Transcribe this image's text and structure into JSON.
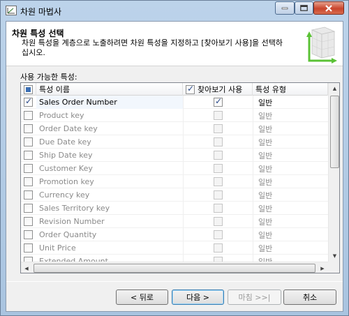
{
  "window": {
    "title": "차원 마법사"
  },
  "header": {
    "title": "차원 특성 선택",
    "description": "차원 특성을 계층으로 노출하려면 차원 특성을 지정하고 [찾아보기 사용]을 선택하십시오."
  },
  "list_label": "사용 가능한 특성:",
  "grid": {
    "columns": {
      "name": "특성 이름",
      "browse": "찾아보기 사용",
      "type": "특성 유형"
    },
    "rows": [
      {
        "name": "Sales Order Number",
        "checked": true,
        "browse": true,
        "type": "일반"
      },
      {
        "name": "Product key",
        "checked": false,
        "browse": false,
        "type": "일반"
      },
      {
        "name": "Order Date key",
        "checked": false,
        "browse": false,
        "type": "일반"
      },
      {
        "name": "Due Date key",
        "checked": false,
        "browse": false,
        "type": "일반"
      },
      {
        "name": "Ship Date key",
        "checked": false,
        "browse": false,
        "type": "일반"
      },
      {
        "name": "Customer Key",
        "checked": false,
        "browse": false,
        "type": "일반"
      },
      {
        "name": "Promotion key",
        "checked": false,
        "browse": false,
        "type": "일반"
      },
      {
        "name": "Currency key",
        "checked": false,
        "browse": false,
        "type": "일반"
      },
      {
        "name": "Sales Territory key",
        "checked": false,
        "browse": false,
        "type": "일반"
      },
      {
        "name": "Revision Number",
        "checked": false,
        "browse": false,
        "type": "일반"
      },
      {
        "name": "Order Quantity",
        "checked": false,
        "browse": false,
        "type": "일반"
      },
      {
        "name": "Unit Price",
        "checked": false,
        "browse": false,
        "type": "일반"
      },
      {
        "name": "Extended Amount",
        "checked": false,
        "browse": false,
        "type": "일반"
      }
    ]
  },
  "buttons": {
    "back": "< 뒤로",
    "next": "다음 >",
    "finish": "마침 >>|",
    "cancel": "취소"
  }
}
